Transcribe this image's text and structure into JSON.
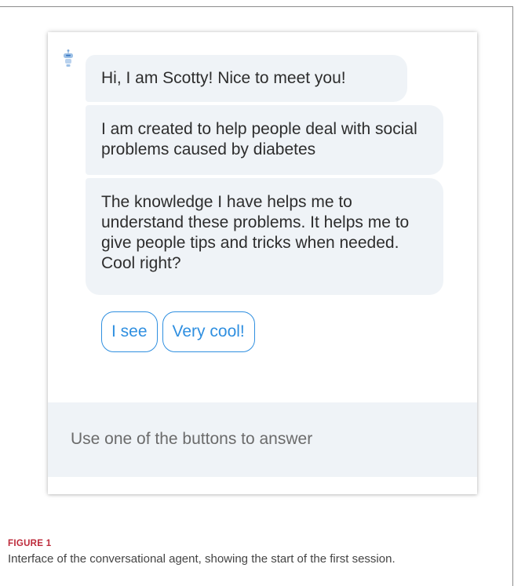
{
  "chat": {
    "messages": [
      {
        "sender": "bot",
        "text": "Hi, I am Scotty! Nice to meet you!"
      },
      {
        "sender": "bot",
        "text": "I am created to help people deal with social problems caused by diabetes"
      },
      {
        "sender": "bot",
        "text": "The knowledge I have helps me to understand these problems. It helps me to give people tips and tricks when needed. Cool right?"
      }
    ],
    "quick_replies": [
      "I see",
      "Very cool!"
    ],
    "input_placeholder": "Use one of the buttons to answer"
  },
  "figure": {
    "label": "FIGURE 1",
    "caption": "Interface of the conversational agent, showing the start of the first session."
  },
  "colors": {
    "accent": "#2f8fe0",
    "bubble_bg": "#eff3f7",
    "figure_label": "#bd2a3a"
  },
  "icons": {
    "bot_avatar": "robot-avatar-icon"
  }
}
